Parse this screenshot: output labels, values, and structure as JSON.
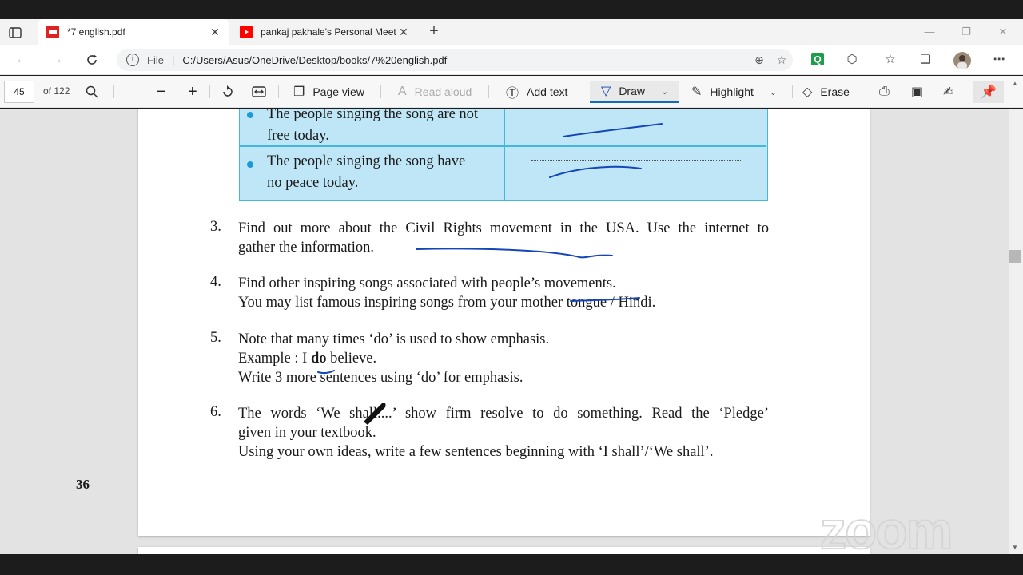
{
  "browser": {
    "tabs": [
      {
        "title": "*7 english.pdf",
        "active": true,
        "favicon": "pdf-icon"
      },
      {
        "title": "pankaj pakhale's Personal Meetin",
        "active": false,
        "favicon": "youtube-icon"
      }
    ],
    "url_scheme": "File",
    "url_path": "C:/Users/Asus/OneDrive/Desktop/books/7%20english.pdf"
  },
  "pdf_toolbar": {
    "page_number": "45",
    "page_total": "of 122",
    "page_view": "Page view",
    "read_aloud": "Read aloud",
    "add_text": "Add text",
    "draw": "Draw",
    "highlight": "Highlight",
    "erase": "Erase"
  },
  "document": {
    "table_rows": [
      {
        "line1": "The people singing the song are not",
        "line2": "free today."
      },
      {
        "line1": "The people singing the song have",
        "line2": "no peace today."
      }
    ],
    "questions": [
      {
        "num": "3.",
        "lines": [
          "Find out more about the Civil Rights movement in the USA. Use the internet to",
          "gather the information."
        ]
      },
      {
        "num": "4.",
        "lines": [
          "Find other inspiring songs associated with people’s movements.",
          "You may list famous inspiring songs from your mother tongue / Hindi."
        ]
      },
      {
        "num": "5.",
        "lines": [
          "Note that many times ‘do’ is used to show emphasis.",
          "Example : I",
          "do",
          "believe.",
          "Write 3 more sentences using ‘do’ for emphasis."
        ]
      },
      {
        "num": "6.",
        "lines": [
          "The words ‘We shall....’ show firm resolve to do something. Read the ‘Pledge’",
          "given in your textbook.",
          "Using your own ideas, write a few sentences beginning with ‘I shall’/‘We shall’."
        ]
      }
    ],
    "page_number": "36"
  },
  "overlay": {
    "watermark": "zoom"
  },
  "colors": {
    "table_fill": "#bfe6f6",
    "table_border": "#45b6de",
    "ink": "#1546b8",
    "accent": "#0f6cbd"
  }
}
